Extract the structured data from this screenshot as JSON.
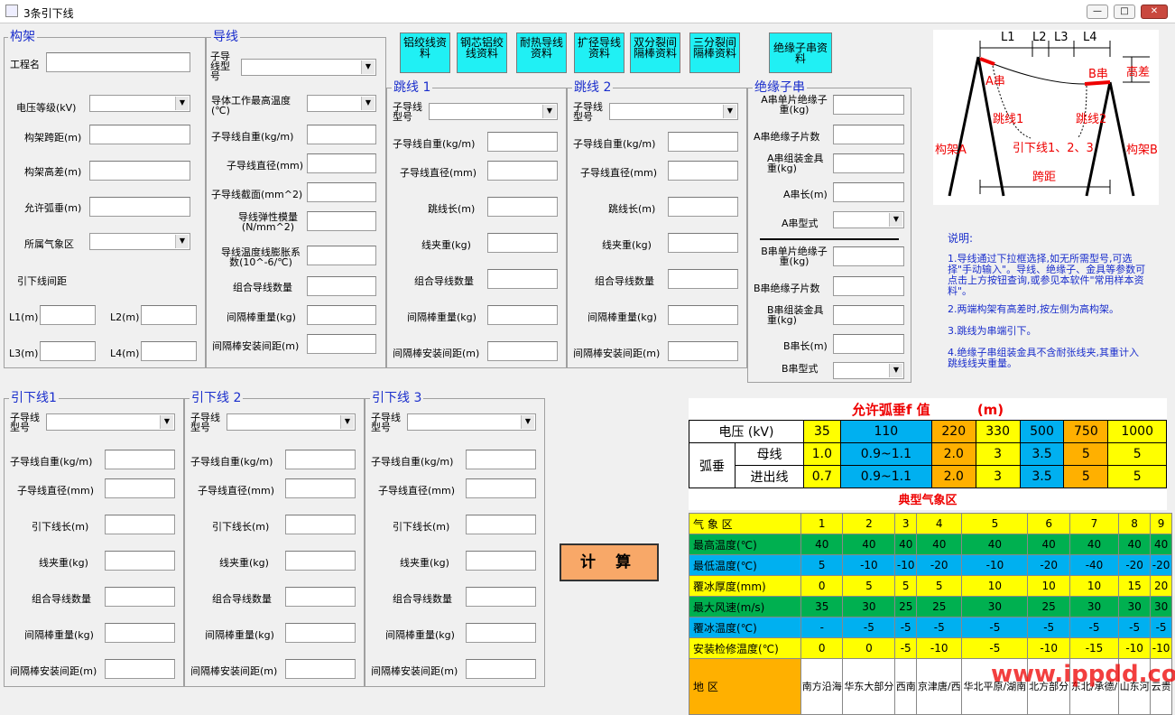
{
  "window": {
    "title": "3条引下线",
    "min": "—",
    "max": "□",
    "close": "✕"
  },
  "frame": {
    "title": "构架",
    "project": "工程名",
    "voltage": "电压等级(kV)",
    "span": "构架跨距(m)",
    "height_diff": "构架高差(m)",
    "sag": "允许弧垂(m)",
    "climate": "所属气象区",
    "spacing": "引下线间距",
    "l1": "L1(m)",
    "l2": "L2(m)",
    "l3": "L3(m)",
    "l4": "L4(m)"
  },
  "conductor": {
    "title": "导线",
    "type": "子导线型号",
    "max_temp": "导体工作最高温度(℃)",
    "weight": "子导线自重(kg/m)",
    "diameter": "子导线直径(mm)",
    "area": "子导线截面(mm^2)",
    "modulus": "导线弹性模量(N/mm^2)",
    "expansion": "导线温度线膨胀系数(10^-6/℃)",
    "count": "组合导线数量",
    "spacer_weight": "间隔棒重量(kg)",
    "spacer_dist": "间隔棒安装间距(m)"
  },
  "buttons": [
    "铝绞线资料",
    "钢芯铝绞线资料",
    "耐热导线资料",
    "扩径导线资料",
    "双分裂间隔棒资料",
    "三分裂间隔棒资料",
    "绝缘子串资料"
  ],
  "jumpers": [
    {
      "title": "跳线 1"
    },
    {
      "title": "跳线 2"
    }
  ],
  "jumper_labels": {
    "type": "子导线型号",
    "weight": "子导线自重(kg/m)",
    "diameter": "子导线直径(mm)",
    "length": "跳线长(m)",
    "clamp": "线夹重(kg)",
    "count": "组合导线数量",
    "spacer_weight": "间隔棒重量(kg)",
    "spacer_dist": "间隔棒安装间距(m)"
  },
  "insulator": {
    "title": "绝缘子串",
    "a_unit": "A串单片绝缘子重(kg)",
    "a_count": "A串绝缘子片数",
    "a_fitting": "A串组装金具重(kg)",
    "a_len": "A串长(m)",
    "a_type": "A串型式",
    "b_unit": "B串单片绝缘子重(kg)",
    "b_count": "B串绝缘子片数",
    "b_fitting": "B串组装金具重(kg)",
    "b_len": "B串长(m)",
    "b_type": "B串型式"
  },
  "downleads": [
    {
      "title": "引下线1"
    },
    {
      "title": "引下线 2"
    },
    {
      "title": "引下线 3"
    }
  ],
  "downlead_labels": {
    "type": "子导线型号",
    "weight": "子导线自重(kg/m)",
    "diameter": "子导线直径(mm)",
    "length": "引下线长(m)",
    "clamp": "线夹重(kg)",
    "count": "组合导线数量",
    "spacer_weight": "间隔棒重量(kg)",
    "spacer_dist": "间隔棒安装间距(m)"
  },
  "calc": "计 算",
  "diagram": {
    "l1": "L1",
    "l2": "L2",
    "l3": "L3",
    "l4": "L4",
    "a": "A串",
    "b": "B串",
    "hd": "高差",
    "j1": "跳线1",
    "j2": "跳线2",
    "leads": "引下线1、2、3",
    "fa": "构架A",
    "fb": "构架B",
    "span": "跨距"
  },
  "notes": {
    "head": "说明:",
    "n1": "1.导线通过下拉框选择,如无所需型号,可选择\"手动输入\"。导线、绝缘子、金具等参数可点击上方按钮查询,或参见本软件\"常用样本资料\"。",
    "n2": "2.两端构架有高差时,按左侧为高构架。",
    "n3": "3.跳线为串端引下。",
    "n4": "4.绝缘子串组装金具不含耐张线夹,其重计入跳线线夹重量。"
  },
  "sag_table": {
    "title": "允许弧垂f 值          (m)",
    "v_label": "电压 (kV)",
    "voltages": [
      "35",
      "110",
      "220",
      "330",
      "500",
      "750",
      "1000"
    ],
    "sag_label": "弧垂",
    "bus": "母线",
    "bus_vals": [
      "1.0",
      "0.9~1.1",
      "2.0",
      "3",
      "3.5",
      "5",
      "5"
    ],
    "io": "进出线",
    "io_vals": [
      "0.7",
      "0.9~1.1",
      "2.0",
      "3",
      "3.5",
      "5",
      "5"
    ]
  },
  "met_table": {
    "title": "典型气象区",
    "rows": [
      {
        "label": "气 象 区",
        "vals": [
          "1",
          "2",
          "3",
          "4",
          "5",
          "6",
          "7",
          "8",
          "9"
        ]
      },
      {
        "label": "最高温度(℃)",
        "vals": [
          "40",
          "40",
          "40",
          "40",
          "40",
          "40",
          "40",
          "40",
          "40"
        ]
      },
      {
        "label": "最低温度(℃)",
        "vals": [
          "5",
          "-10",
          "-10",
          "-20",
          "-10",
          "-20",
          "-40",
          "-20",
          "-20"
        ]
      },
      {
        "label": "覆冰厚度(mm)",
        "vals": [
          "0",
          "5",
          "5",
          "5",
          "10",
          "10",
          "10",
          "15",
          "20"
        ]
      },
      {
        "label": "最大风速(m/s)",
        "vals": [
          "35",
          "30",
          "25",
          "25",
          "30",
          "25",
          "30",
          "30",
          "30"
        ]
      },
      {
        "label": "覆冰温度(℃)",
        "vals": [
          "-",
          "-5",
          "-5",
          "-5",
          "-5",
          "-5",
          "-5",
          "-5",
          "-5"
        ]
      },
      {
        "label": "安装检修温度(℃)",
        "vals": [
          "0",
          "0",
          "-5",
          "-10",
          "-5",
          "-10",
          "-15",
          "-10",
          "-10"
        ]
      }
    ],
    "region_label": "地 区",
    "regions": [
      "南方沿海",
      "华东大部分",
      "西南",
      "京津唐/西",
      "华北平原/湖南",
      "北方部分",
      "东北/承德/",
      "山东河",
      "云贵"
    ]
  },
  "watermark": "www.ippdd.com"
}
